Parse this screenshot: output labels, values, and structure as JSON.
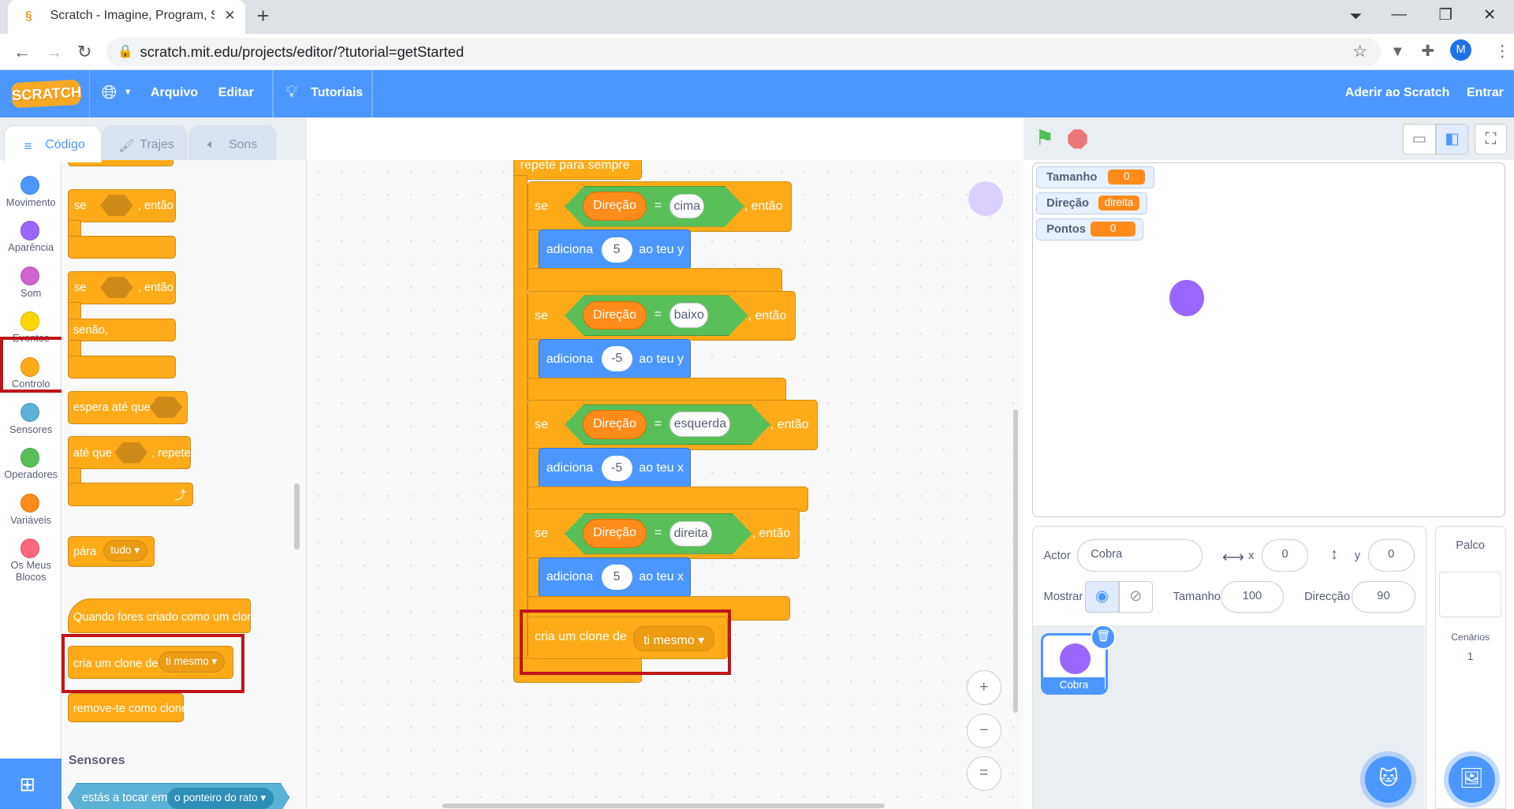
{
  "browser": {
    "tab_title": "Scratch - Imagine, Program, Shar",
    "url": "scratch.mit.edu/projects/editor/?tutorial=getStarted",
    "profile_initial": "M"
  },
  "menu": {
    "logo": "SCRATCH",
    "file": "Arquivo",
    "edit": "Editar",
    "tutorials": "Tutoriais",
    "join": "Aderir ao Scratch",
    "signin": "Entrar"
  },
  "tabs": {
    "code": "Código",
    "costumes": "Trajes",
    "sounds": "Sons"
  },
  "categories": [
    {
      "label": "Movimento",
      "color": "#4c97ff"
    },
    {
      "label": "Aparência",
      "color": "#9966ff"
    },
    {
      "label": "Som",
      "color": "#cf63cf"
    },
    {
      "label": "Eventos",
      "color": "#ffd500"
    },
    {
      "label": "Controlo",
      "color": "#ffab19"
    },
    {
      "label": "Sensores",
      "color": "#5cb1d6"
    },
    {
      "label": "Operadores",
      "color": "#59c059"
    },
    {
      "label": "Variáveis",
      "color": "#ff8c1a"
    },
    {
      "label": "Os Meus Blocos",
      "color": "#ff6680"
    }
  ],
  "palette": {
    "if_then_se": "se",
    "if_then_then": ", então",
    "ifelse_se": "se",
    "ifelse_then": ", então",
    "ifelse_else": "senão,",
    "wait_until": "espera até que",
    "repeat_until": "até que",
    "repeat_until_repeat": ", repete",
    "stop": "pára",
    "stop_option": "tudo",
    "when_clone": "Quando fores criado como um clone",
    "create_clone": "cria um clone de",
    "create_clone_option": "ti mesmo",
    "delete_clone": "remove-te como clone",
    "sensing_header": "Sensores",
    "touching": "estás a tocar em",
    "touching_option": "o ponteiro do rato"
  },
  "script": {
    "forever": "repete para sempre",
    "if_word": "se",
    "then_word": ", então",
    "var_name": "Direção",
    "eq": "=",
    "branches": [
      {
        "value": "cima",
        "action": "adiciona",
        "amount": "5",
        "axis": "ao teu y"
      },
      {
        "value": "baixo",
        "action": "adiciona",
        "amount": "-5",
        "axis": "ao teu y"
      },
      {
        "value": "esquerda",
        "action": "adiciona",
        "amount": "-5",
        "axis": "ao teu x"
      },
      {
        "value": "direita",
        "action": "adiciona",
        "amount": "5",
        "axis": "ao teu x"
      }
    ],
    "clone_label": "cria um clone de",
    "clone_option": "ti mesmo"
  },
  "zoom": {
    "in": "+",
    "out": "−",
    "reset": "="
  },
  "monitors": [
    {
      "label": "Tamanho",
      "value": "0"
    },
    {
      "label": "Direção",
      "value": "direita"
    },
    {
      "label": "Pontos",
      "value": "0"
    }
  ],
  "sprite_info": {
    "actor_label": "Actor",
    "actor_name": "Cobra",
    "x_label": "x",
    "x_value": "0",
    "y_label": "y",
    "y_value": "0",
    "show_label": "Mostrar",
    "size_label": "Tamanho",
    "size_value": "100",
    "direction_label": "Direcção",
    "direction_value": "90"
  },
  "sprite_tile": {
    "name": "Cobra"
  },
  "stage_panel": {
    "title": "Palco",
    "backdrops_label": "Cenários",
    "backdrops_count": "1"
  },
  "colors": {
    "accent": "#4c97ff",
    "control": "#ffab19",
    "operator": "#59c059",
    "variable": "#ff8c1a",
    "sprite": "#9966ff",
    "highlight": "#c0141a"
  }
}
